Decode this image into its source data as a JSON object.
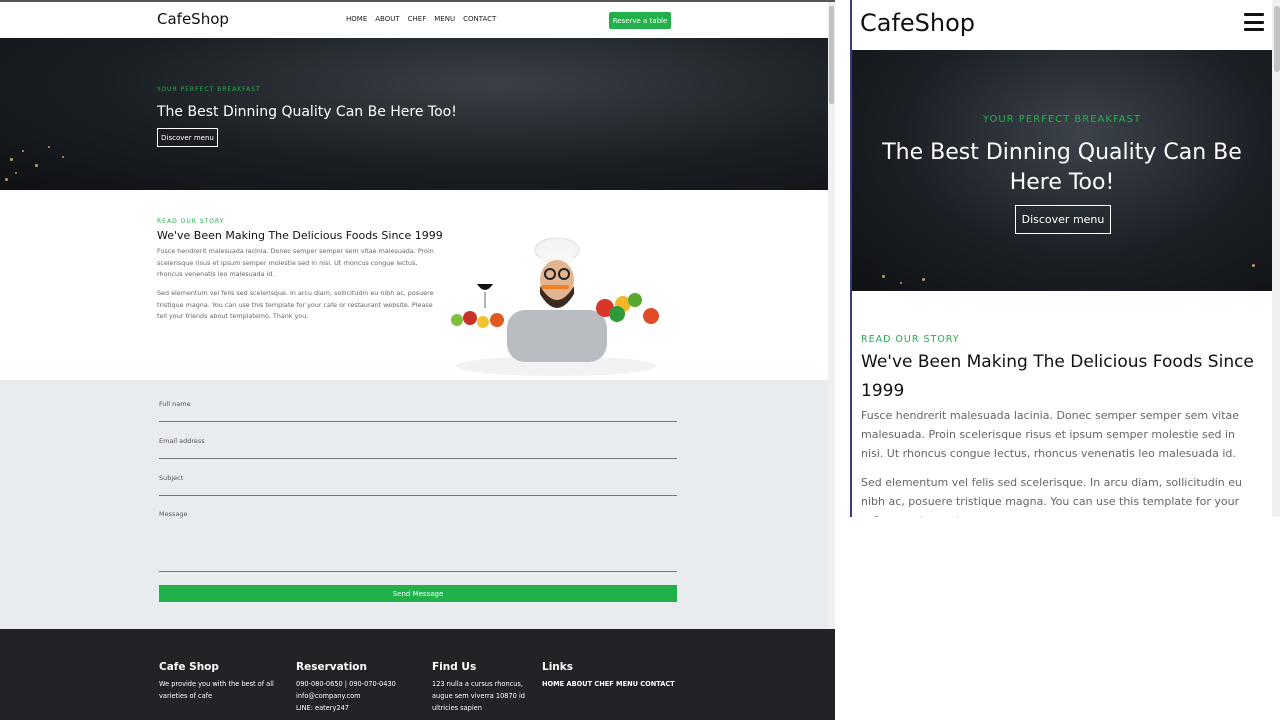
{
  "site": {
    "brand": "CafeShop",
    "nav": [
      "HOME",
      "ABOUT",
      "CHEF",
      "MENU",
      "CONTACT"
    ],
    "reserve_label": "Reserve a table"
  },
  "hero": {
    "kicker": "YOUR PERFECT BREAKFAST",
    "title": "The Best Dinning Quality Can Be Here Too!",
    "button": "Discover menu"
  },
  "story": {
    "kicker": "READ OUR STORY",
    "title": "We've Been Making The Delicious Foods Since 1999",
    "p1": "Fusce hendrerit malesuada lacinia. Donec semper semper sem vitae malesuada. Proin scelerisque risus et ipsum semper molestie sed in nisi. Ut rhoncus congue lectus, rhoncus venenatis leo malesuada id.",
    "p2": "Sed elementum vel felis sed scelerisque. In arcu diam, sollicitudin eu nibh ac, posuere tristique magna. You can use this template for your cafe or restaurant website. Please tell your friends about templatemo. Thank you."
  },
  "form": {
    "full_name": "Full name",
    "email": "Email address",
    "subject": "Subject",
    "message": "Message",
    "send": "Send Message"
  },
  "footer": {
    "col1_title": "Cafe Shop",
    "col1_text": "We provide you with the best of all varieties of cafe",
    "col2_title": "Reservation",
    "col2_line1": "090-080-0650 | 090-070-0430",
    "col2_line2": "info@company.com",
    "col2_line3": "LINE: eatery247",
    "col3_title": "Find Us",
    "col3_text": "123 nulla a cursus rhoncus, augue sem viverra 10870 id ultricies sapien",
    "col4_title": "Links",
    "col4_text": "HOME ABOUT CHEF MENU CONTACT"
  },
  "mobile": {
    "story_p2_partial": "Sed elementum vel felis sed scelerisque. In arcu diam, sollicitudin eu nibh ac, posuere tristique magna. You can use this template for your cafe or restaurant"
  },
  "colors": {
    "accent": "#22b04b",
    "footer_bg": "#212327",
    "form_bg": "#e9ecef"
  }
}
